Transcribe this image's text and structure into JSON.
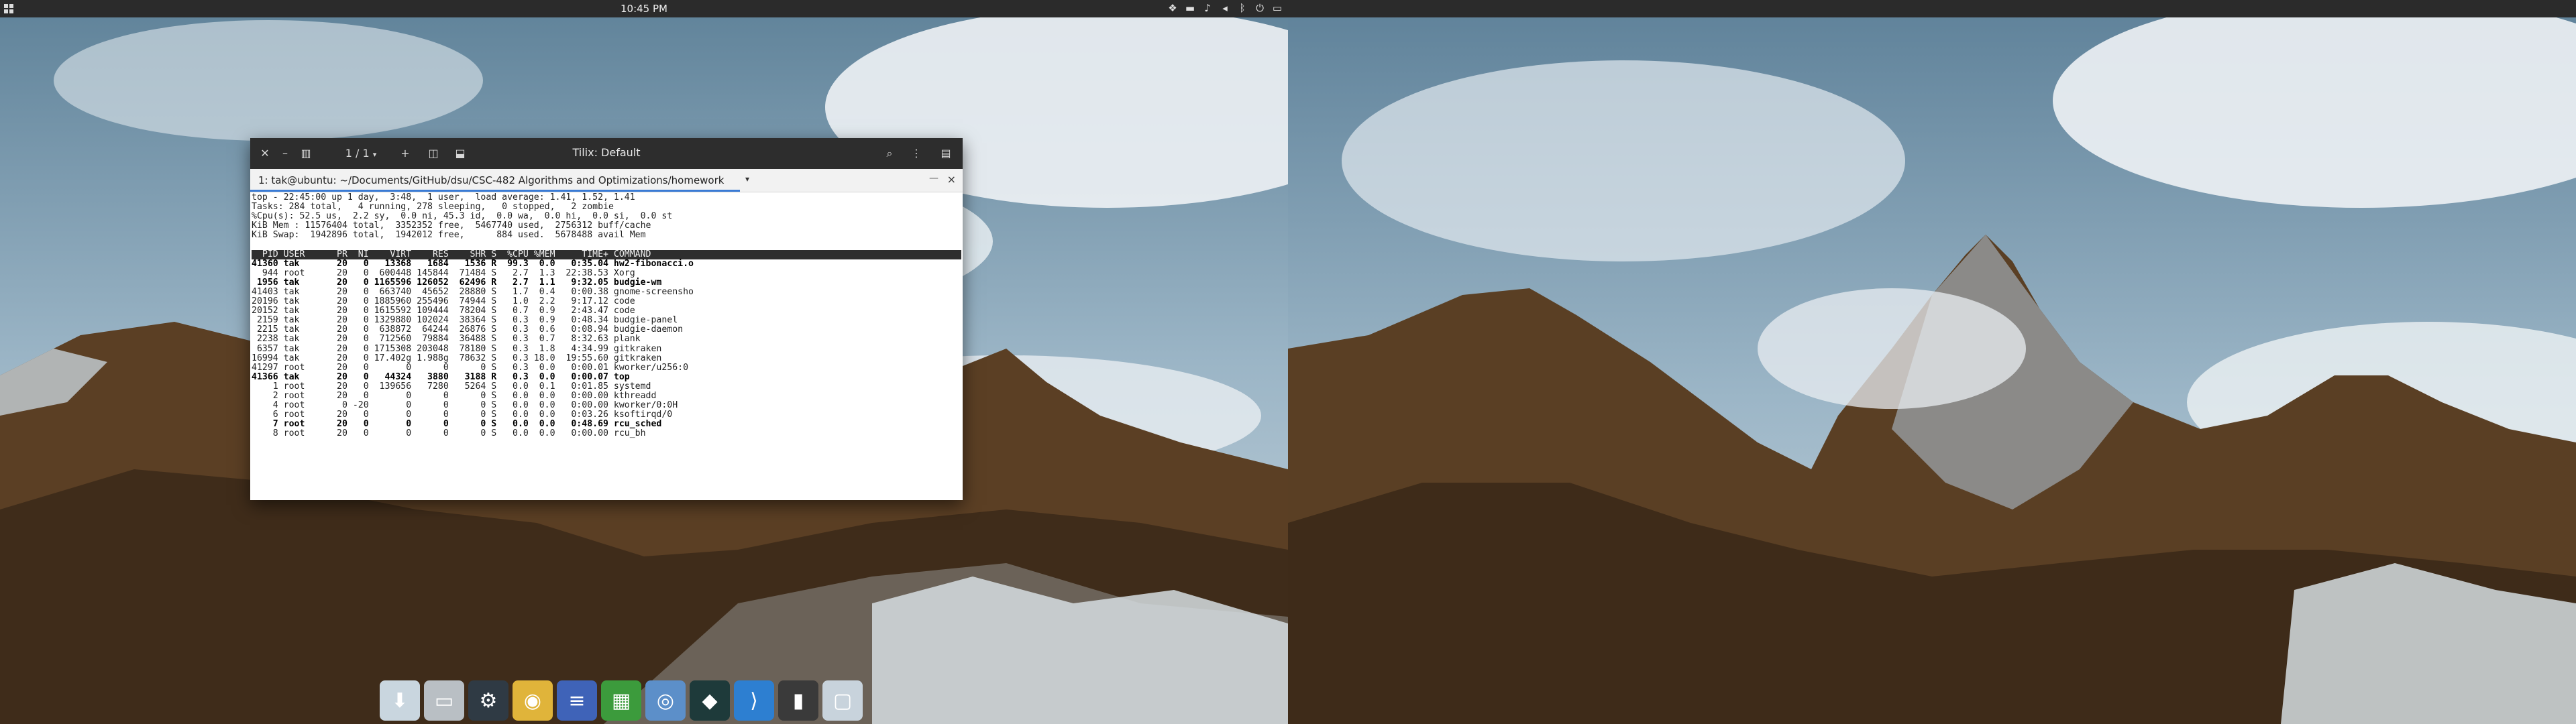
{
  "panel": {
    "clock": "10:45 PM",
    "tray_icons": [
      "dropbox-icon",
      "folder-icon",
      "bell-icon",
      "volume-icon",
      "bluetooth-icon",
      "power-icon",
      "notification-icon"
    ]
  },
  "window": {
    "title": "Tilix: Default",
    "session_counter": "1 / 1",
    "tab_label": "1: tak@ubuntu: ~/Documents/GitHub/dsu/CSC-482 Algorithms and Optimizations/homework",
    "tab_close": "×",
    "close_glyph": "✕",
    "minimize_glyph": "–"
  },
  "top": {
    "summary_lines": [
      "top - 22:45:00 up 1 day,  3:48,  1 user,  load average: 1.41, 1.52, 1.41",
      "Tasks: 284 total,   4 running, 278 sleeping,   0 stopped,   2 zombie",
      "%Cpu(s): 52.5 us,  2.2 sy,  0.0 ni, 45.3 id,  0.0 wa,  0.0 hi,  0.0 si,  0.0 st",
      "KiB Mem : 11576404 total,  3352352 free,  5467740 used,  2756312 buff/cache",
      "KiB Swap:  1942896 total,  1942012 free,      884 used.  5678488 avail Mem"
    ],
    "header": "  PID USER      PR  NI    VIRT    RES    SHR S  %CPU %MEM     TIME+ COMMAND",
    "processes": [
      {
        "line": "41360 tak       20   0   13368   1684   1536 R  99.3  0.0   0:35.04 hw2-fibonacci.o",
        "bold": true
      },
      {
        "line": "  944 root      20   0  600448 145844  71484 S   2.7  1.3  22:38.53 Xorg",
        "bold": false
      },
      {
        "line": " 1956 tak       20   0 1165596 126052  62496 R   2.7  1.1   9:32.05 budgie-wm",
        "bold": true
      },
      {
        "line": "41403 tak       20   0  663740  45652  28880 S   1.7  0.4   0:00.38 gnome-screensho",
        "bold": false
      },
      {
        "line": "20196 tak       20   0 1885960 255496  74944 S   1.0  2.2   9:17.12 code",
        "bold": false
      },
      {
        "line": "20152 tak       20   0 1615592 109444  78204 S   0.7  0.9   2:43.47 code",
        "bold": false
      },
      {
        "line": " 2159 tak       20   0 1329880 102024  38364 S   0.3  0.9   0:48.34 budgie-panel",
        "bold": false
      },
      {
        "line": " 2215 tak       20   0  638872  64244  26876 S   0.3  0.6   0:08.94 budgie-daemon",
        "bold": false
      },
      {
        "line": " 2238 tak       20   0  712560  79884  36488 S   0.3  0.7   8:32.63 plank",
        "bold": false
      },
      {
        "line": " 6357 tak       20   0 1715308 203048  78180 S   0.3  1.8   4:34.99 gitkraken",
        "bold": false
      },
      {
        "line": "16994 tak       20   0 17.402g 1.988g  78632 S   0.3 18.0  19:55.60 gitkraken",
        "bold": false
      },
      {
        "line": "41297 root      20   0       0      0      0 S   0.3  0.0   0:00.01 kworker/u256:0",
        "bold": false
      },
      {
        "line": "41366 tak       20   0   44324   3880   3188 R   0.3  0.0   0:00.07 top",
        "bold": true
      },
      {
        "line": "    1 root      20   0  139656   7280   5264 S   0.0  0.1   0:01.85 systemd",
        "bold": false
      },
      {
        "line": "    2 root      20   0       0      0      0 S   0.0  0.0   0:00.00 kthreadd",
        "bold": false
      },
      {
        "line": "    4 root       0 -20       0      0      0 S   0.0  0.0   0:00.00 kworker/0:0H",
        "bold": false
      },
      {
        "line": "    6 root      20   0       0      0      0 S   0.0  0.0   0:03.26 ksoftirqd/0",
        "bold": false
      },
      {
        "line": "    7 root      20   0       0      0      0 S   0.0  0.0   0:48.69 rcu_sched",
        "bold": true
      },
      {
        "line": "    8 root      20   0       0      0      0 S   0.0  0.0   0:00.00 rcu_bh",
        "bold": false
      }
    ]
  },
  "dock": {
    "items": [
      {
        "name": "dock-downloads",
        "icon": "download-icon",
        "color": "#c9d6df"
      },
      {
        "name": "dock-files",
        "icon": "folder-icon",
        "color": "#b9bfc4"
      },
      {
        "name": "dock-settings",
        "icon": "settings-icon",
        "color": "#2f3a44"
      },
      {
        "name": "dock-rhythmbox",
        "icon": "music-icon",
        "color": "#e0b43a"
      },
      {
        "name": "dock-writer",
        "icon": "document-icon",
        "color": "#3f63b8"
      },
      {
        "name": "dock-calc",
        "icon": "spreadsheet-icon",
        "color": "#3c9b3c"
      },
      {
        "name": "dock-chromium",
        "icon": "browser-icon",
        "color": "#5c8fc9"
      },
      {
        "name": "dock-gitkraken",
        "icon": "gitkraken-icon",
        "color": "#1e3a3a"
      },
      {
        "name": "dock-vscode",
        "icon": "vscode-icon",
        "color": "#2d7fd1"
      },
      {
        "name": "dock-terminal",
        "icon": "terminal-icon",
        "color": "#3a3a3a"
      },
      {
        "name": "dock-window",
        "icon": "window-icon",
        "color": "#c8d3dc"
      }
    ]
  }
}
